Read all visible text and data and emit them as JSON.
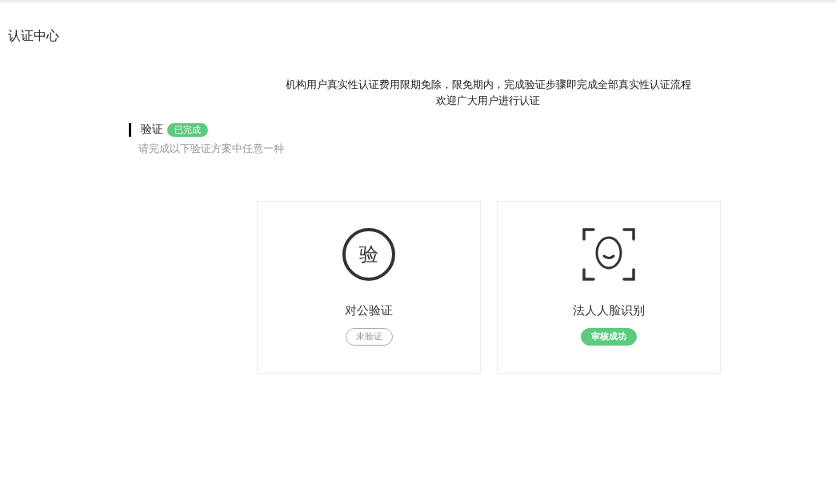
{
  "page_title": "认证中心",
  "notice": [
    "机构用户真实性认证费用限期免除，限免期内，完成验证步骤即完成全部真实性认证流程",
    "欢迎广大用户进行认证"
  ],
  "section": {
    "title": "验证",
    "badge": "已完成",
    "done": true,
    "subtitle": "请完成以下验证方案中任意一种"
  },
  "methods": [
    {
      "kind": "seal",
      "icon_text": "验",
      "name": "对公验证",
      "status": "未验证",
      "verified": false
    },
    {
      "kind": "face",
      "name": "法人人脸识别",
      "status": "审核成功",
      "verified": true
    }
  ]
}
